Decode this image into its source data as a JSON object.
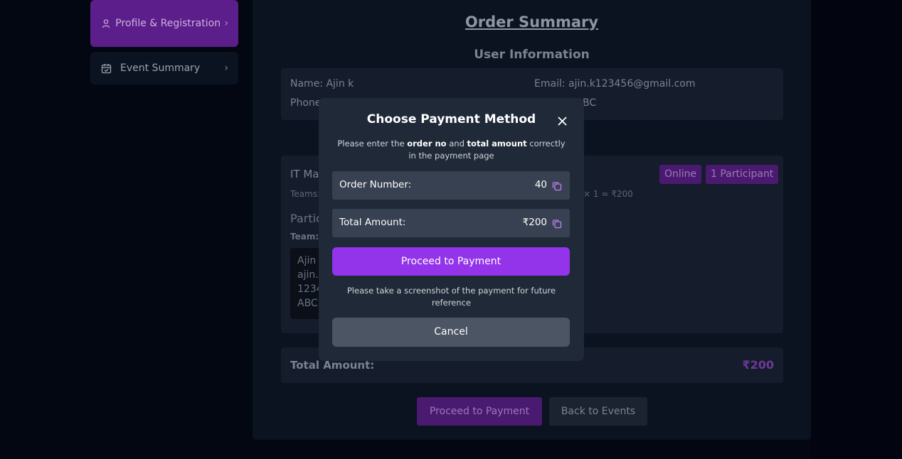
{
  "sidebar": {
    "items": [
      {
        "label": "Profile & Registration",
        "active": true,
        "icon": "user-icon"
      },
      {
        "label": "Event Summary",
        "active": false,
        "icon": "calendar-check-icon"
      }
    ]
  },
  "page": {
    "title": "Order Summary",
    "user_info_title": "User Information",
    "user": {
      "name": "Name: Ajin k",
      "email": "Email: ajin.k123456@gmail.com",
      "phone_partial": "Phone",
      "college_partial": "BC"
    },
    "event": {
      "name_partial": "IT Ma",
      "teams_partial": "Teams:",
      "price_calc_partial": "× 1 = ₹200",
      "badge_mode": "Online",
      "badge_participants": "1 Participant",
      "participants_partial": "Partic",
      "team_label_partial": "Team:",
      "member_lines": [
        "Ajin",
        "ajin.",
        "1234",
        "ABC"
      ]
    },
    "total_label": "Total Amount:",
    "total_value": "₹200",
    "proceed_label": "Proceed to Payment",
    "back_label": "Back to Events"
  },
  "modal": {
    "title": "Choose Payment Method",
    "note_prefix": "Please enter the ",
    "note_bold1": "order no",
    "note_mid": " and ",
    "note_bold2": "total amount",
    "note_suffix": " correctly in the payment page",
    "order_label": "Order Number:",
    "order_value": "40",
    "amount_label": "Total Amount:",
    "amount_value": "₹200",
    "proceed_label": "Proceed to Payment",
    "screenshot_note": "Please take a screenshot of the payment for future reference",
    "cancel_label": "Cancel"
  },
  "colors": {
    "accent": "#9333ea",
    "modal_bg": "#1f2937",
    "field_bg": "#374151",
    "cancel_bg": "#4b5563"
  }
}
